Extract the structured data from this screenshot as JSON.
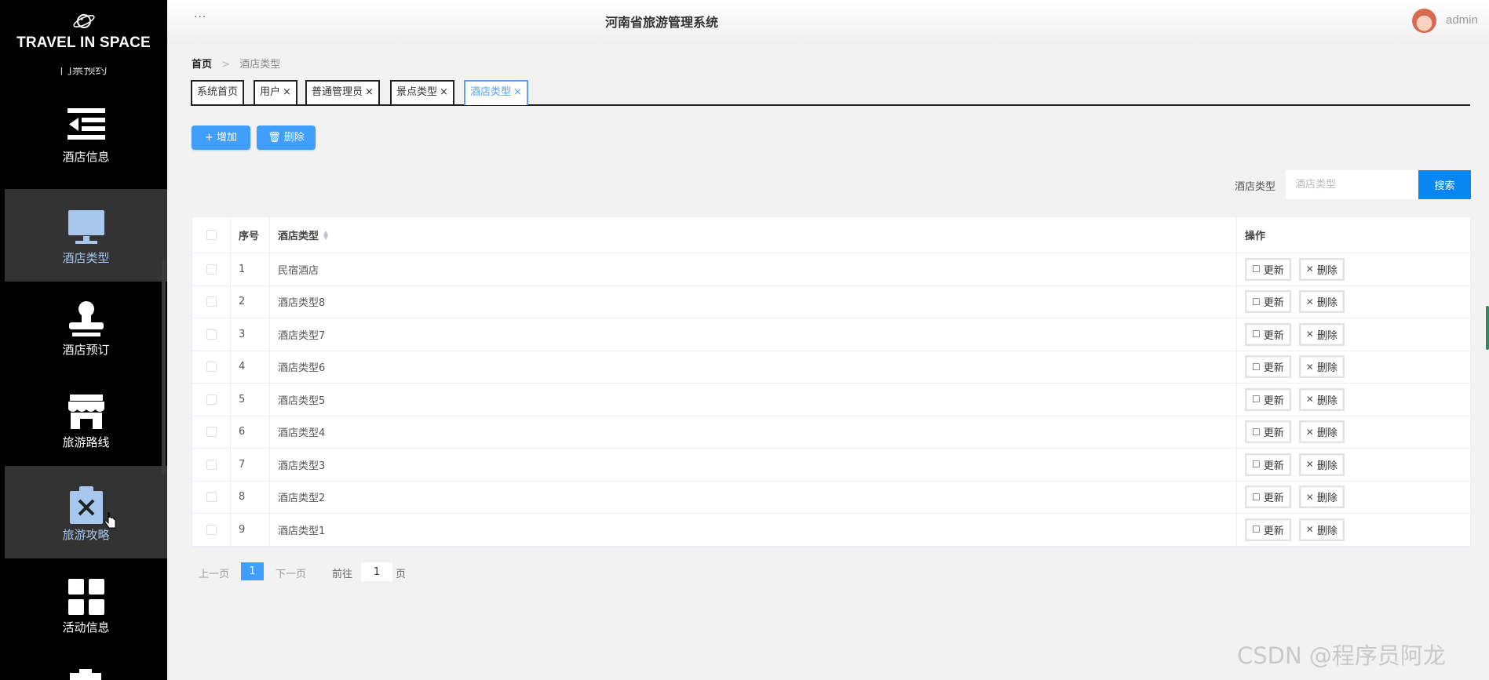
{
  "brand": {
    "name": "TRAVEL IN SPACE",
    "cut_label": "门票预约"
  },
  "sidebar": {
    "items": [
      {
        "label": "酒店信息",
        "icon": "list-indent-icon",
        "active": false
      },
      {
        "label": "酒店类型",
        "icon": "monitor-icon",
        "active": true
      },
      {
        "label": "酒店预订",
        "icon": "stamp-icon",
        "active": false
      },
      {
        "label": "旅游路线",
        "icon": "shop-icon",
        "active": false
      },
      {
        "label": "旅游攻略",
        "icon": "clipboard-x-icon",
        "active": true
      },
      {
        "label": "活动信息",
        "icon": "grid-icon",
        "active": false
      }
    ]
  },
  "header": {
    "menu_dots": "···",
    "title": "河南省旅游管理系统",
    "username": "admin"
  },
  "breadcrumb": {
    "home": "首页",
    "separator": ">",
    "current": "酒店类型"
  },
  "tags": [
    {
      "label": "系统首页",
      "closable": false
    },
    {
      "label": "用户",
      "closable": true
    },
    {
      "label": "普通管理员",
      "closable": true
    },
    {
      "label": "景点类型",
      "closable": true
    },
    {
      "label": "酒店类型",
      "closable": true,
      "active": true
    }
  ],
  "toolbar": {
    "add_label": "增加",
    "delete_label": "删除"
  },
  "search": {
    "label": "酒店类型",
    "placeholder": "酒店类型",
    "button": "搜索"
  },
  "table": {
    "headers": {
      "index": "序号",
      "type": "酒店类型",
      "ops": "操作"
    },
    "rows": [
      {
        "index": "1",
        "type": "民宿酒店"
      },
      {
        "index": "2",
        "type": "酒店类型8"
      },
      {
        "index": "3",
        "type": "酒店类型7"
      },
      {
        "index": "4",
        "type": "酒店类型6"
      },
      {
        "index": "5",
        "type": "酒店类型5"
      },
      {
        "index": "6",
        "type": "酒店类型4"
      },
      {
        "index": "7",
        "type": "酒店类型3"
      },
      {
        "index": "8",
        "type": "酒店类型2"
      },
      {
        "index": "9",
        "type": "酒店类型1"
      }
    ],
    "update_label": "更新",
    "delete_label": "删除"
  },
  "pagination": {
    "prev": "上一页",
    "current": "1",
    "next": "下一页",
    "goto": "前往",
    "goto_value": "1",
    "unit": "页"
  },
  "watermark": "CSDN @程序员阿龙",
  "colors": {
    "primary": "#409eff",
    "search_button": "#0a86f2",
    "sidebar_bg": "#000000",
    "active_menu_bg": "#333333"
  }
}
